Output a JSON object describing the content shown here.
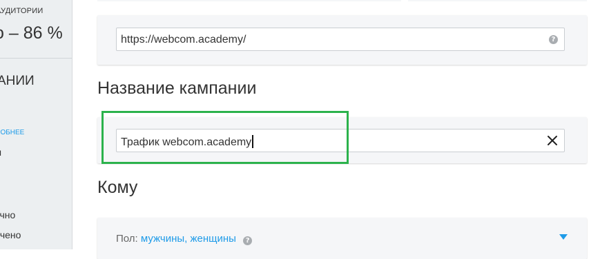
{
  "sidebar": {
    "audience_label": "АУДИТОРИИ",
    "audience_value": "о – 86 %",
    "campaign_title": "АНИИ",
    "more_link": "РОБНЕЕ",
    "items": [
      "ы",
      "очно",
      "ичено"
    ]
  },
  "url_field": {
    "value": "https://webcom.academy/",
    "help_icon": "?"
  },
  "campaign_name": {
    "title": "Название кампании",
    "value": "Трафик webcom.academy",
    "clear_icon": "close-icon"
  },
  "whom": {
    "title": "Кому",
    "gender_label": "Пол:",
    "gender_value": "мужчины, женщины",
    "help_icon": "?"
  },
  "colors": {
    "accent": "#1e9be8",
    "highlight": "#2bb24c",
    "sidebar_bg": "#eceff1",
    "card_bg": "#f5f6f8"
  }
}
